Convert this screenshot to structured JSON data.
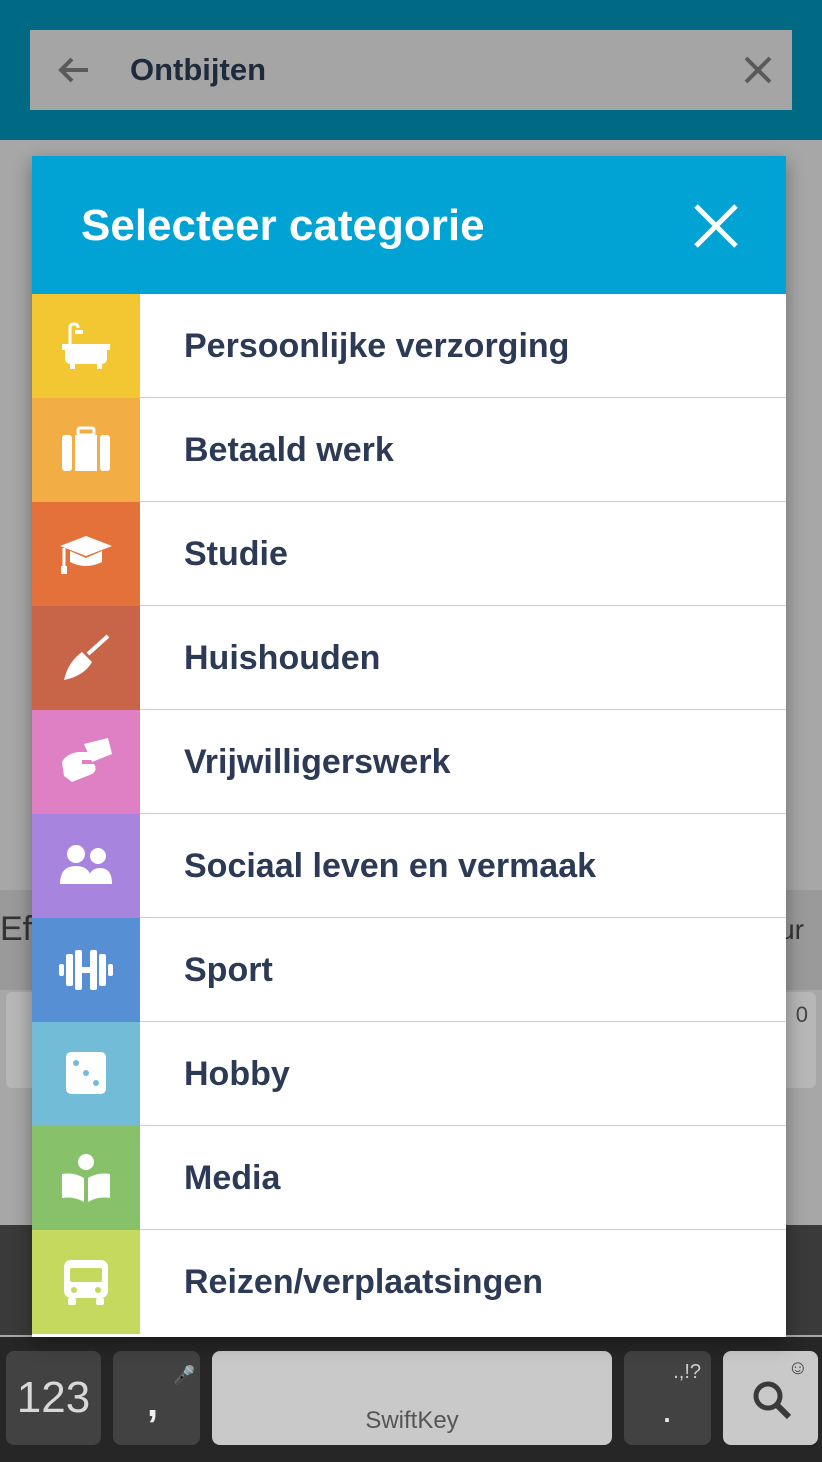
{
  "search": {
    "title": "Ontbijten"
  },
  "background": {
    "left_text": "Ef",
    "right_text": "ur",
    "card_number": "0"
  },
  "keyboard": {
    "key_123": "123",
    "comma": ",",
    "punct": ".,!?",
    "dot": ".",
    "space_brand": "SwiftKey"
  },
  "dialog": {
    "title": "Selecteer categorie",
    "categories": [
      {
        "label": "Persoonlijke verzorging",
        "color": "#f2c731",
        "icon": "bathtub-icon"
      },
      {
        "label": "Betaald werk",
        "color": "#f2ad45",
        "icon": "briefcase-icon"
      },
      {
        "label": "Studie",
        "color": "#e5713a",
        "icon": "graduation-cap-icon"
      },
      {
        "label": "Huishouden",
        "color": "#c86548",
        "icon": "broom-icon"
      },
      {
        "label": "Vrijwilligerswerk",
        "color": "#df80c4",
        "icon": "helping-hand-icon"
      },
      {
        "label": "Sociaal leven en vermaak",
        "color": "#a784dd",
        "icon": "people-icon"
      },
      {
        "label": "Sport",
        "color": "#568fd4",
        "icon": "dumbbell-icon"
      },
      {
        "label": "Hobby",
        "color": "#72bcd7",
        "icon": "dice-icon"
      },
      {
        "label": "Media",
        "color": "#87c26a",
        "icon": "reading-icon"
      },
      {
        "label": "Reizen/verplaatsingen",
        "color": "#c5d95e",
        "icon": "bus-icon"
      }
    ]
  }
}
